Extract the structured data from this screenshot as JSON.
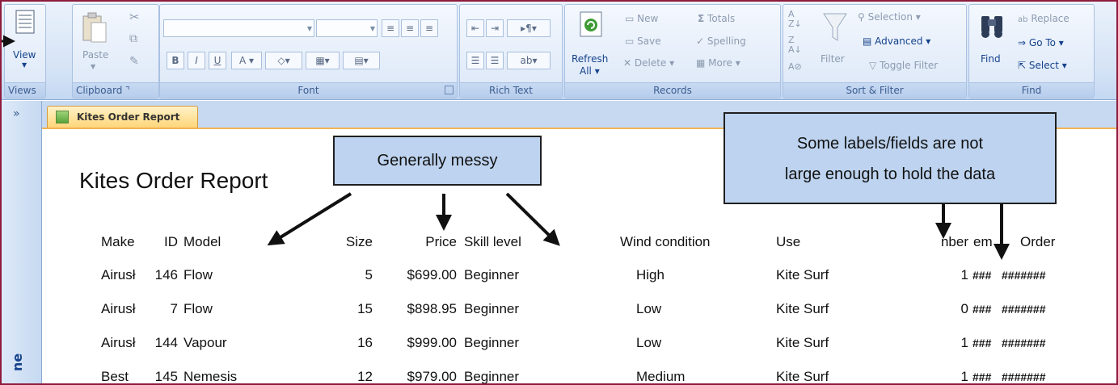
{
  "ribbon": {
    "views": {
      "view_label": "View",
      "group_label": "Views"
    },
    "clipboard": {
      "paste_label": "Paste",
      "group_label": "Clipboard"
    },
    "font": {
      "group_label": "Font",
      "bold": "B",
      "italic": "I",
      "underline": "U",
      "font_color": "A"
    },
    "rich_text": {
      "group_label": "Rich Text"
    },
    "records": {
      "refresh_label": "Refresh",
      "refresh_sub": "All",
      "new_label": "New",
      "save_label": "Save",
      "delete_label": "Delete",
      "totals_label": "Totals",
      "spelling_label": "Spelling",
      "more_label": "More",
      "group_label": "Records"
    },
    "sort_filter": {
      "filter_label": "Filter",
      "selection_label": "Selection",
      "advanced_label": "Advanced",
      "toggle_filter_label": "Toggle Filter",
      "group_label": "Sort & Filter"
    },
    "find": {
      "find_label": "Find",
      "replace_label": "Replace",
      "goto_label": "Go To",
      "select_label": "Select",
      "group_label": "Find"
    }
  },
  "nav": {
    "toggle": "»",
    "pane_label": "ne"
  },
  "tab": {
    "label": "Kites Order Report"
  },
  "report": {
    "title": "Kites Order Report",
    "headers": {
      "make": "Make",
      "id": "ID",
      "model": "Model",
      "size": "Size",
      "price": "Price",
      "skill": "Skill level",
      "wind": "Wind condition",
      "use": "Use",
      "number": "nber",
      "item": "em",
      "order": "Order"
    },
    "rows": [
      {
        "make": "Airusł",
        "id": "146",
        "model": "Flow",
        "size": "5",
        "price": "$699.00",
        "skill": "Beginner",
        "wind": "High",
        "use": "Kite Surf",
        "number": "1",
        "item": "###",
        "order": "#######"
      },
      {
        "make": "Airusł",
        "id": "7",
        "model": "Flow",
        "size": "15",
        "price": "$898.95",
        "skill": "Beginner",
        "wind": "Low",
        "use": "Kite Surf",
        "number": "0",
        "item": "###",
        "order": "#######"
      },
      {
        "make": "Airusł",
        "id": "144",
        "model": "Vapour",
        "size": "16",
        "price": "$999.00",
        "skill": "Beginner",
        "wind": "Low",
        "use": "Kite Surf",
        "number": "1",
        "item": "###",
        "order": "#######"
      },
      {
        "make": "Best",
        "id": "145",
        "model": "Nemesis",
        "size": "12",
        "price": "$979.00",
        "skill": "Beginner",
        "wind": "Medium",
        "use": "Kite Surf",
        "number": "1",
        "item": "###",
        "order": "#######"
      }
    ]
  },
  "callouts": {
    "messy": "Generally messy",
    "labels_line1": "Some labels/fields are not",
    "labels_line2": "large enough to hold the data"
  },
  "colors": {
    "frame": "#8e1b3d",
    "ribbon_text": "#15428b",
    "callout_fill": "#bdd3ef",
    "tab_accent": "#f2b453"
  }
}
